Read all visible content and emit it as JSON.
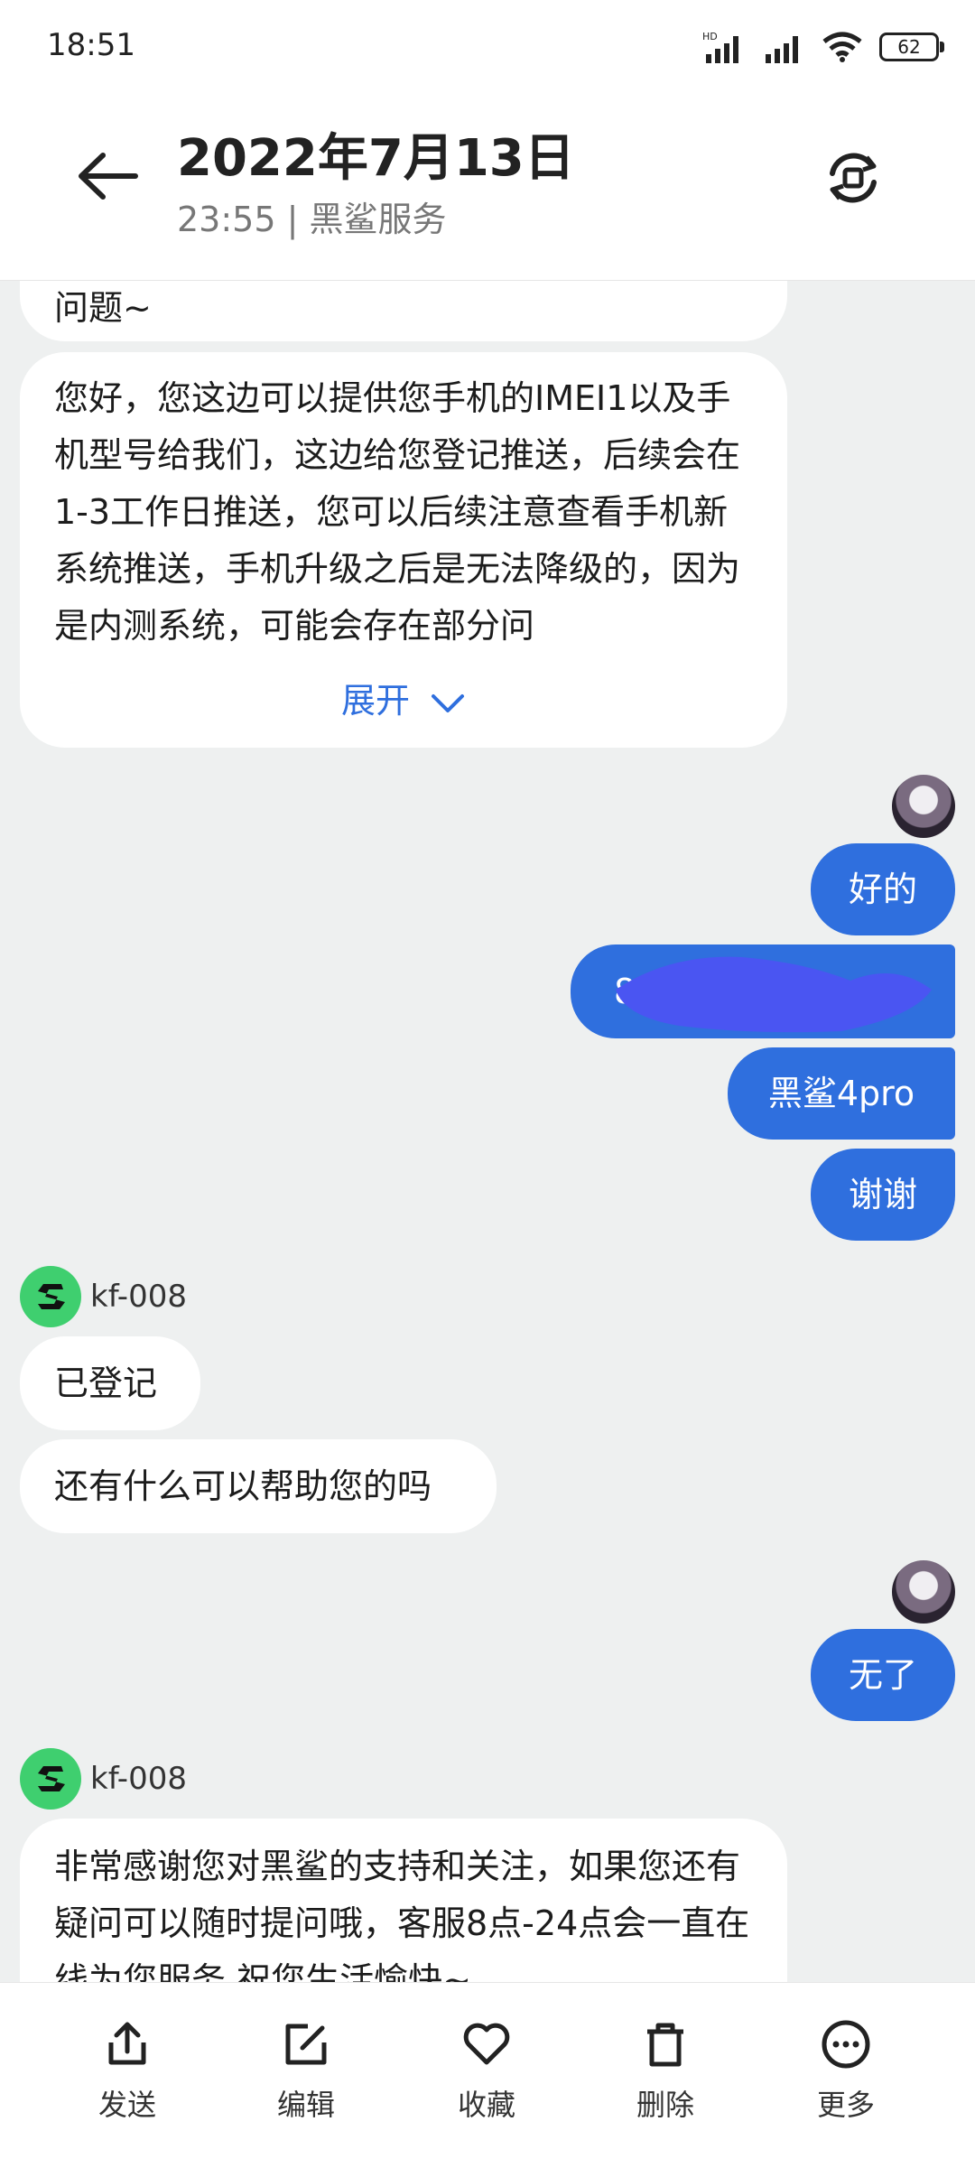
{
  "status": {
    "time": "18:51",
    "battery": "62",
    "network_label": "HD"
  },
  "header": {
    "title": "2022年7月13日",
    "subtitle": "23:55 | 黑鲨服务"
  },
  "chat": {
    "messages": [
      {
        "from": "agent",
        "text": "问题~"
      },
      {
        "from": "agent",
        "text": "您好，您这边可以提供您手机的IMEI1以及手机型号给我们，这边给您登记推送，后续会在1-3工作日推送，您可以后续注意查看手机新系统推送，手机升级之后是无法降级的，因为是内测系统，可能会存在部分问",
        "expand_label": "展开"
      },
      {
        "from": "user",
        "text": "好的"
      },
      {
        "from": "user",
        "text": "8",
        "redacted": true
      },
      {
        "from": "user",
        "text": "黑鲨4pro"
      },
      {
        "from": "user",
        "text": "谢谢"
      },
      {
        "from": "agent",
        "agent_name": "kf-008",
        "text": "已登记"
      },
      {
        "from": "agent",
        "text": "还有什么可以帮助您的吗"
      },
      {
        "from": "user",
        "text": "无了"
      },
      {
        "from": "agent",
        "agent_name": "kf-008",
        "text": "非常感谢您对黑鲨的支持和关注，如果您还有疑问可以随时提问哦，客服8点-24点会一直在线为您服务,祝您生活愉快~"
      }
    ]
  },
  "toolbar": {
    "items": [
      {
        "label": "发送",
        "icon": "share-icon"
      },
      {
        "label": "编辑",
        "icon": "edit-icon"
      },
      {
        "label": "收藏",
        "icon": "heart-icon"
      },
      {
        "label": "删除",
        "icon": "trash-icon"
      },
      {
        "label": "更多",
        "icon": "more-icon"
      }
    ]
  },
  "colors": {
    "user_bubble": "#2f6fde",
    "agent_bubble": "#ffffff",
    "chat_background": "#eef0f0",
    "agent_avatar": "#3fcf6f",
    "link": "#2f6fde"
  }
}
